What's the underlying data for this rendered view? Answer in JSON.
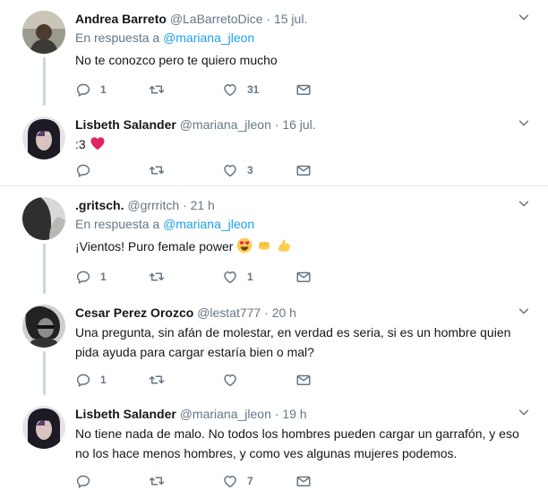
{
  "threads": [
    {
      "tweets": [
        {
          "name": "Andrea Barreto",
          "handle": "@LaBarretoDice",
          "time": "15 jul.",
          "reply_prefix": "En respuesta a",
          "reply_to": "@mariana_jleon",
          "text": "No te conozco pero te quiero mucho",
          "replies": "1",
          "retweets": "",
          "likes": "31"
        },
        {
          "name": "Lisbeth Salander",
          "handle": "@mariana_jleon",
          "time": "16 jul.",
          "text": ":3",
          "emoji": [
            "heart"
          ],
          "replies": "",
          "retweets": "",
          "likes": "3"
        }
      ]
    },
    {
      "tweets": [
        {
          "name": ".gritsch.",
          "handle": "@grrritch",
          "time": "21 h",
          "reply_prefix": "En respuesta a",
          "reply_to": "@mariana_jleon",
          "text": "¡Vientos! Puro female power",
          "emoji": [
            "heart-eyes-face",
            "fist-bump",
            "flexed-biceps"
          ],
          "replies": "1",
          "retweets": "",
          "likes": "1"
        },
        {
          "name": "Cesar Perez Orozco",
          "handle": "@lestat777",
          "time": "20 h",
          "text_line1": "Una pregunta, sin afán de molestar, en verdad es seria, si es un hombre quien",
          "text_line2": "pida ayuda para cargar estaría bien o mal?",
          "replies": "1",
          "retweets": "",
          "likes": ""
        },
        {
          "name": "Lisbeth Salander",
          "handle": "@mariana_jleon",
          "time": "19 h",
          "text_line1": "No tiene nada de malo. No todos los hombres pueden cargar un garrafón, y eso",
          "text_line2": "no los hace menos hombres, y como ves algunas mujeres podemos.",
          "replies": "",
          "retweets": "",
          "likes": "7"
        }
      ]
    }
  ],
  "dot": "·",
  "colors": {
    "name": "#14171a",
    "meta": "#657786",
    "link": "#1da1f2",
    "connector": "#ccd6dd",
    "divider": "#e6ecf0"
  }
}
